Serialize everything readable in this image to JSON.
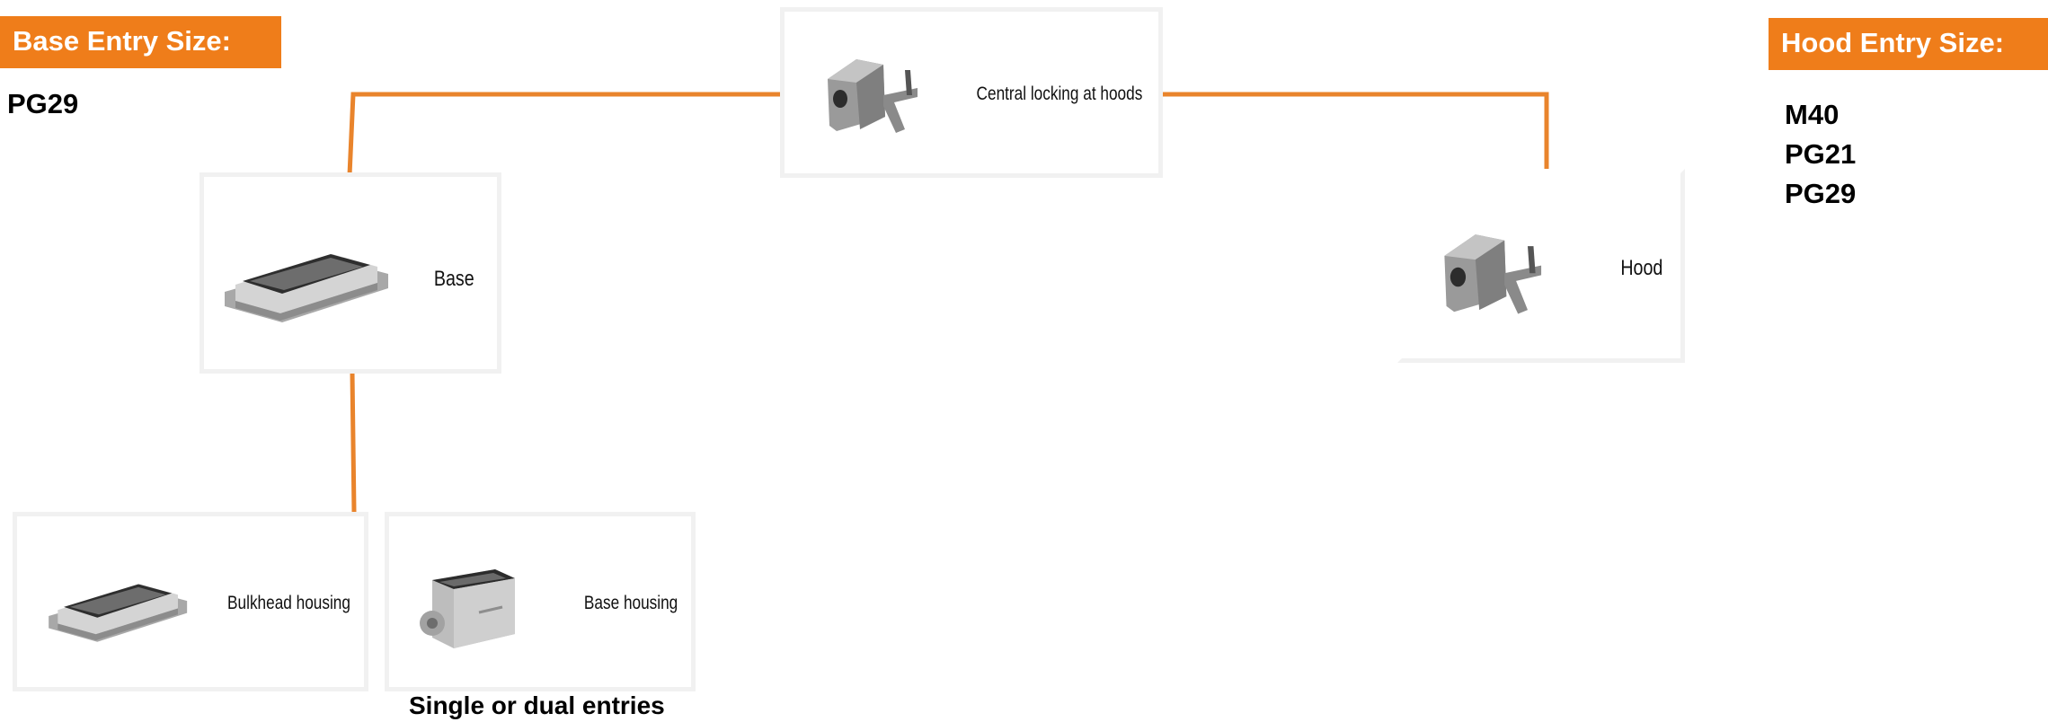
{
  "colors": {
    "accent": "#ef7d1a",
    "connector": "#e9842c"
  },
  "base_entry": {
    "title": "Base Entry Size:",
    "sizes": [
      "PG29"
    ]
  },
  "hood_entry": {
    "title": "Hood Entry Size:",
    "sizes": [
      "M40",
      "PG21",
      "PG29"
    ]
  },
  "nodes": {
    "central": {
      "label": "Central locking at hoods",
      "icon": "hood-with-lever-icon"
    },
    "base": {
      "label": "Base",
      "icon": "base-housing-icon"
    },
    "hood": {
      "label": "Hood",
      "icon": "hood-with-lever-icon"
    },
    "bulkhead": {
      "label": "Bulkhead housing",
      "icon": "bulkhead-housing-icon"
    },
    "base_housing": {
      "label": "Base housing",
      "icon": "surface-base-housing-icon"
    }
  },
  "caption": "Single or dual entries"
}
